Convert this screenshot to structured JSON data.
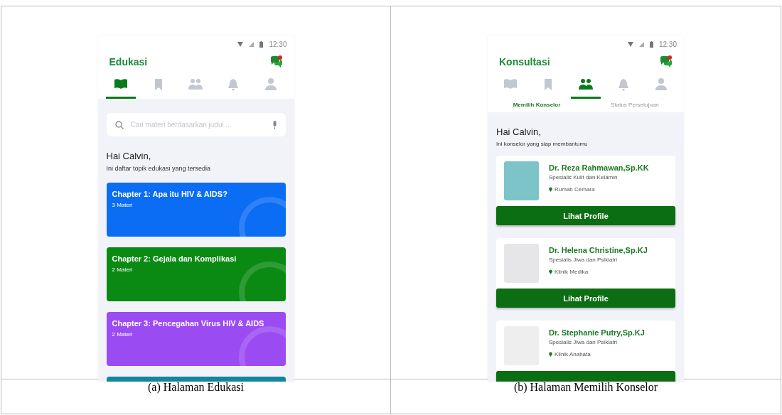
{
  "panels": [
    {
      "kind": "edukasi",
      "status_bar": {
        "time": "12:30"
      },
      "title": "Edukasi",
      "nav_tabs": [
        {
          "kind": "book",
          "selected": true
        },
        {
          "kind": "bookmark",
          "selected": false
        },
        {
          "kind": "people",
          "selected": false
        },
        {
          "kind": "bell",
          "selected": false
        },
        {
          "kind": "person",
          "selected": false
        }
      ],
      "search": {
        "placeholder": "Cari materi berdasarkan judul ..."
      },
      "greeting": "Hai Calvin,",
      "subtitle": "Ini daftar topik edukasi yang tersedia",
      "chapters": [
        {
          "title": "Chapter 1: Apa itu HIV & AIDS?",
          "count": "3 Materi",
          "color": "#0b6cf4"
        },
        {
          "title": "Chapter 2: Gejala dan Komplikasi",
          "count": "2 Materi",
          "color": "#0a8a12"
        },
        {
          "title": "Chapter 3: Pencegahan Virus HIV & AIDS",
          "count": "2 Materi",
          "color": "#9a4cf2"
        },
        {
          "color": "#13869c"
        }
      ],
      "caption": "(a) Halaman Edukasi"
    },
    {
      "kind": "konsultasi",
      "status_bar": {
        "time": "12:30"
      },
      "title": "Konsultasi",
      "nav_tabs": [
        {
          "kind": "book",
          "selected": false
        },
        {
          "kind": "bookmark",
          "selected": false
        },
        {
          "kind": "people",
          "selected": true
        },
        {
          "kind": "bell",
          "selected": false
        },
        {
          "kind": "person",
          "selected": false
        }
      ],
      "sub_tabs": [
        {
          "label": "Memilih Konselor",
          "selected": true
        },
        {
          "label": "Status Persetujuan",
          "selected": false
        }
      ],
      "greeting": "Hai Calvin,",
      "subtitle": "Ini konselor yang siap membantumu",
      "counselors": [
        {
          "name": "Dr. Reza Rahmawan,Sp.KK",
          "specialty": "Spesialis Kulit dan Kelamin",
          "location": "Rumah Cemara",
          "button": "Lihat Profile"
        },
        {
          "name": "Dr. Helena Christine,Sp.KJ",
          "specialty": "Spesialis Jiwa dan Psikiatri",
          "location": "Klinik Medika",
          "button": "Lihat Profile"
        },
        {
          "name": "Dr. Stephanie Putry,Sp.KJ",
          "specialty": "Spesialis Jiwa dan Psikiatri",
          "location": "Klinik Anahata"
        }
      ],
      "caption": "(b) Halaman Memilih Konselor"
    }
  ]
}
